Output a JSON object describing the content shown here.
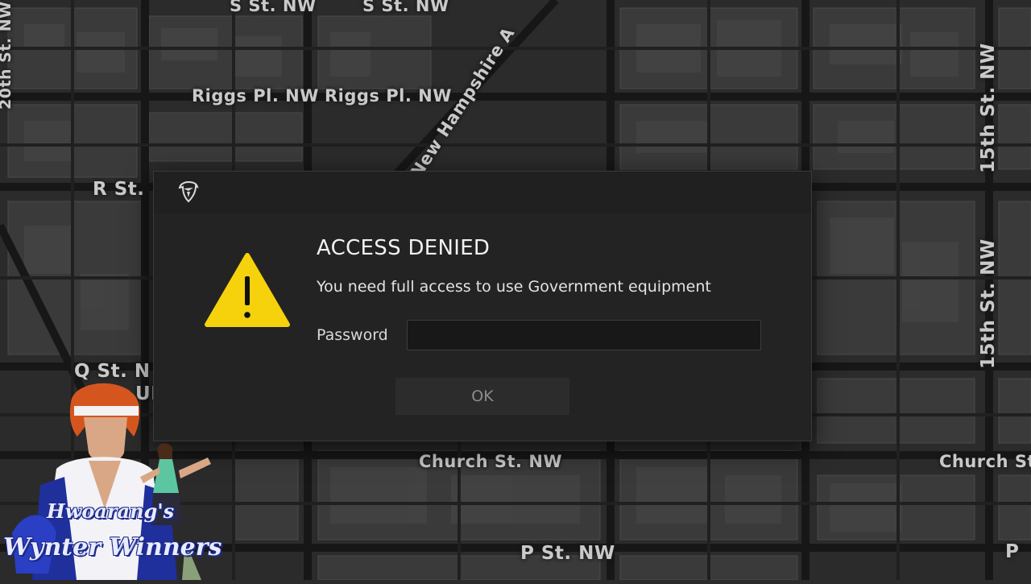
{
  "map": {
    "street_labels": [
      "S St. NW",
      "S St. NW",
      "Riggs Pl. NW",
      "Riggs Pl. NW",
      "New Hampshire A",
      "R St.",
      "Q St. N",
      "UP",
      "Church St. NW",
      "Church St",
      "P St. NW",
      "P",
      "20th St. NW",
      "15th St. NW",
      "15th St. NW"
    ]
  },
  "dialog": {
    "app_icon": "shield-emblem-icon",
    "warning_icon": "warning-triangle-icon",
    "title": "ACCESS DENIED",
    "message": "You need full access to use Government equipment",
    "password_label": "Password",
    "password_value": "",
    "ok_label": "OK"
  },
  "watermark": {
    "line1": "Hwoarang's",
    "line2": "Wynter Winners"
  },
  "colors": {
    "dialog_bg": "#232323",
    "warning_yellow": "#f5d20c",
    "map_bg": "#2b2b2b",
    "watermark_blue": "#1c2a8a"
  }
}
